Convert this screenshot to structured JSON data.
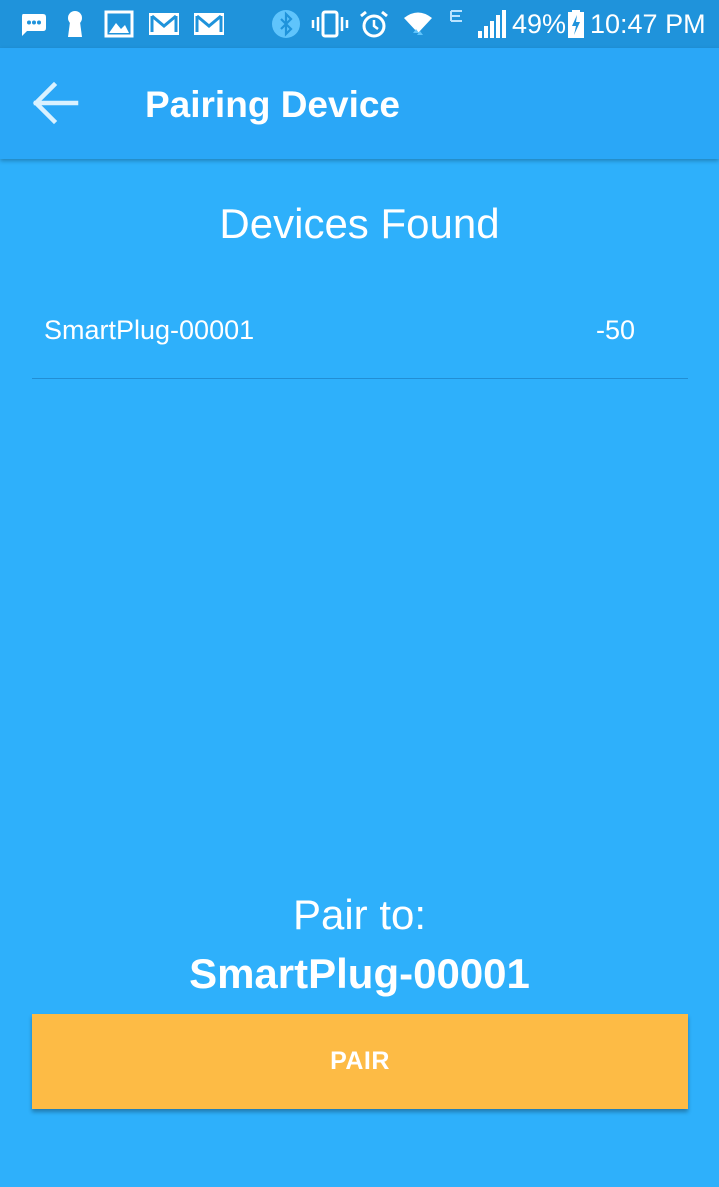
{
  "status_bar": {
    "battery_percent": "49%",
    "time": "10:47 PM",
    "icons": [
      "chat-icon",
      "keyhole-icon",
      "gallery-icon",
      "gmail-icon",
      "gmail-icon",
      "bluetooth-icon",
      "vibrate-icon",
      "alarm-icon",
      "wifi-icon",
      "edge-network-icon",
      "signal-icon",
      "battery-charging-icon"
    ]
  },
  "app_bar": {
    "title": "Pairing Device",
    "back_icon": "arrow-left-icon"
  },
  "devices": {
    "title": "Devices Found",
    "items": [
      {
        "name": "SmartPlug-00001",
        "rssi": "-50"
      }
    ]
  },
  "pair": {
    "label": "Pair to:",
    "target": "SmartPlug-00001",
    "button_label": "PAIR"
  },
  "colors": {
    "status_bar": "#1f93db",
    "app_bar": "#2aa7f7",
    "background": "#2eb0fb",
    "pair_button": "#fdbb45",
    "text": "#ffffff"
  }
}
